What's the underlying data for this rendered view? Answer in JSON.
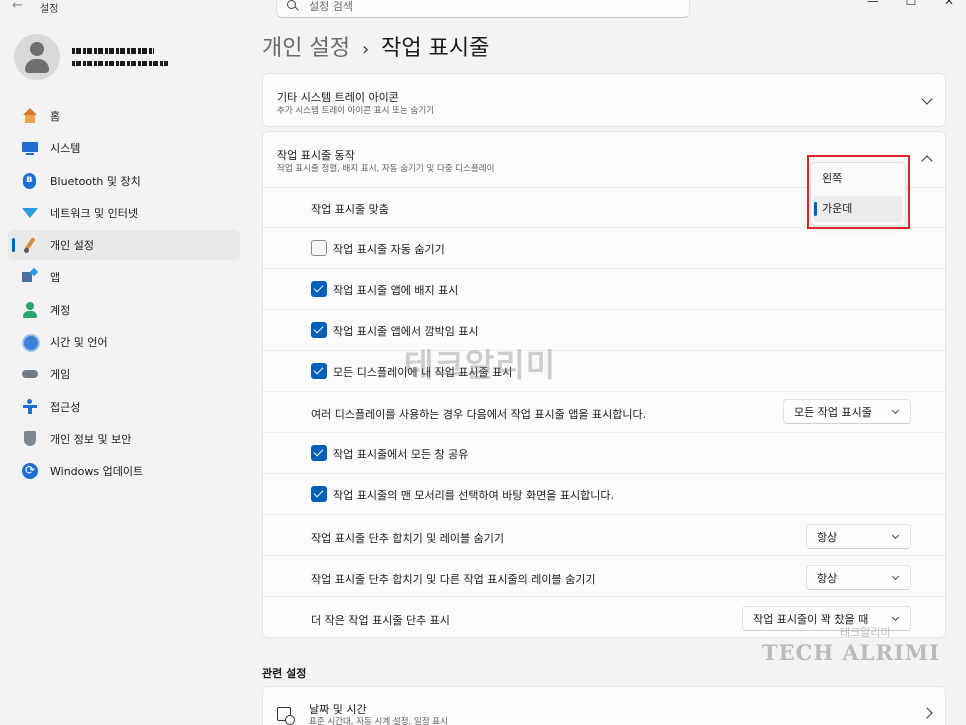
{
  "window": {
    "back_glyph": "←",
    "title": "설정",
    "controls": [
      "—",
      "☐",
      "✕"
    ]
  },
  "search": {
    "placeholder": "설정 검색"
  },
  "breadcrumb": {
    "parent": "개인 설정",
    "separator": "›",
    "current": "작업 표시줄"
  },
  "sidebar": {
    "items": [
      {
        "label": "홈",
        "icon": "home-icon",
        "active": false
      },
      {
        "label": "시스템",
        "icon": "system-icon",
        "active": false
      },
      {
        "label": "Bluetooth 및 장치",
        "icon": "bluetooth-icon",
        "active": false
      },
      {
        "label": "네트워크 및 인터넷",
        "icon": "network-icon",
        "active": false
      },
      {
        "label": "개인 설정",
        "icon": "personalization-icon",
        "active": true
      },
      {
        "label": "앱",
        "icon": "apps-icon",
        "active": false
      },
      {
        "label": "계정",
        "icon": "account-icon",
        "active": false
      },
      {
        "label": "시간 및 언어",
        "icon": "time-language-icon",
        "active": false
      },
      {
        "label": "게임",
        "icon": "gaming-icon",
        "active": false
      },
      {
        "label": "접근성",
        "icon": "accessibility-icon",
        "active": false
      },
      {
        "label": "개인 정보 및 보안",
        "icon": "privacy-icon",
        "active": false
      },
      {
        "label": "Windows 업데이트",
        "icon": "update-icon",
        "active": false
      }
    ]
  },
  "tray_card": {
    "title": "기타 시스템 트레이 아이콘",
    "subtitle": "추가 시스템 트레이 아이콘 표시 또는 숨기기"
  },
  "behavior_card": {
    "title": "작업 표시줄 동작",
    "subtitle": "작업 표시줄 정렬, 배지 표시, 자동 숨기기 및 다중 디스플레이"
  },
  "alignment": {
    "label": "작업 표시줄 맞춤",
    "options": [
      "왼쪽",
      "가운데"
    ],
    "selected": "가운데"
  },
  "settings": {
    "autohide": {
      "label": "작업 표시줄 자동 숨기기",
      "checked": false
    },
    "badges": {
      "label": "작업 표시줄 앱에 배지 표시",
      "checked": true
    },
    "flashing": {
      "label": "작업 표시줄 앱에서 깜박임 표시",
      "checked": true
    },
    "all_displays": {
      "label": "모든 디스플레이에 내 작업 표시줄 표시",
      "checked": true
    },
    "multi_display": {
      "label": "여러 디스플레이를 사용하는 경우 다음에서 작업 표시줄 앱을 표시합니다.",
      "value": "모든 작업 표시줄"
    },
    "share_windows": {
      "label": "작업 표시줄에서 모든 창 공유",
      "checked": true
    },
    "corner_desktop": {
      "label": "작업 표시줄의 맨 모서리를 선택하여 바탕 화면을 표시합니다.",
      "checked": true
    },
    "combine_main": {
      "label": "작업 표시줄 단추 합치기 및 레이블 숨기기",
      "value": "항상"
    },
    "combine_other": {
      "label": "작업 표시줄 단추 합치기 및 다른 작업 표시줄의 레이블 숨기기",
      "value": "항상"
    },
    "smaller_buttons": {
      "label": "더 작은 작업 표시줄 단추 표시",
      "value": "작업 표시줄이 꽉 찼을 때"
    }
  },
  "related": {
    "heading": "관련 설정",
    "date_time": {
      "title": "날짜 및 시간",
      "subtitle": "표준 시간대, 자동 시계 설정, 일정 표시"
    }
  },
  "watermarks": {
    "main": "테크알리미",
    "logo_text": "TECH ALRIMI",
    "logo_small": "테크알리미"
  },
  "colors": {
    "accent": "#005fb8",
    "highlight_box": "#d9242b",
    "background": "#f3f3f3",
    "card": "#fbfbfb"
  }
}
